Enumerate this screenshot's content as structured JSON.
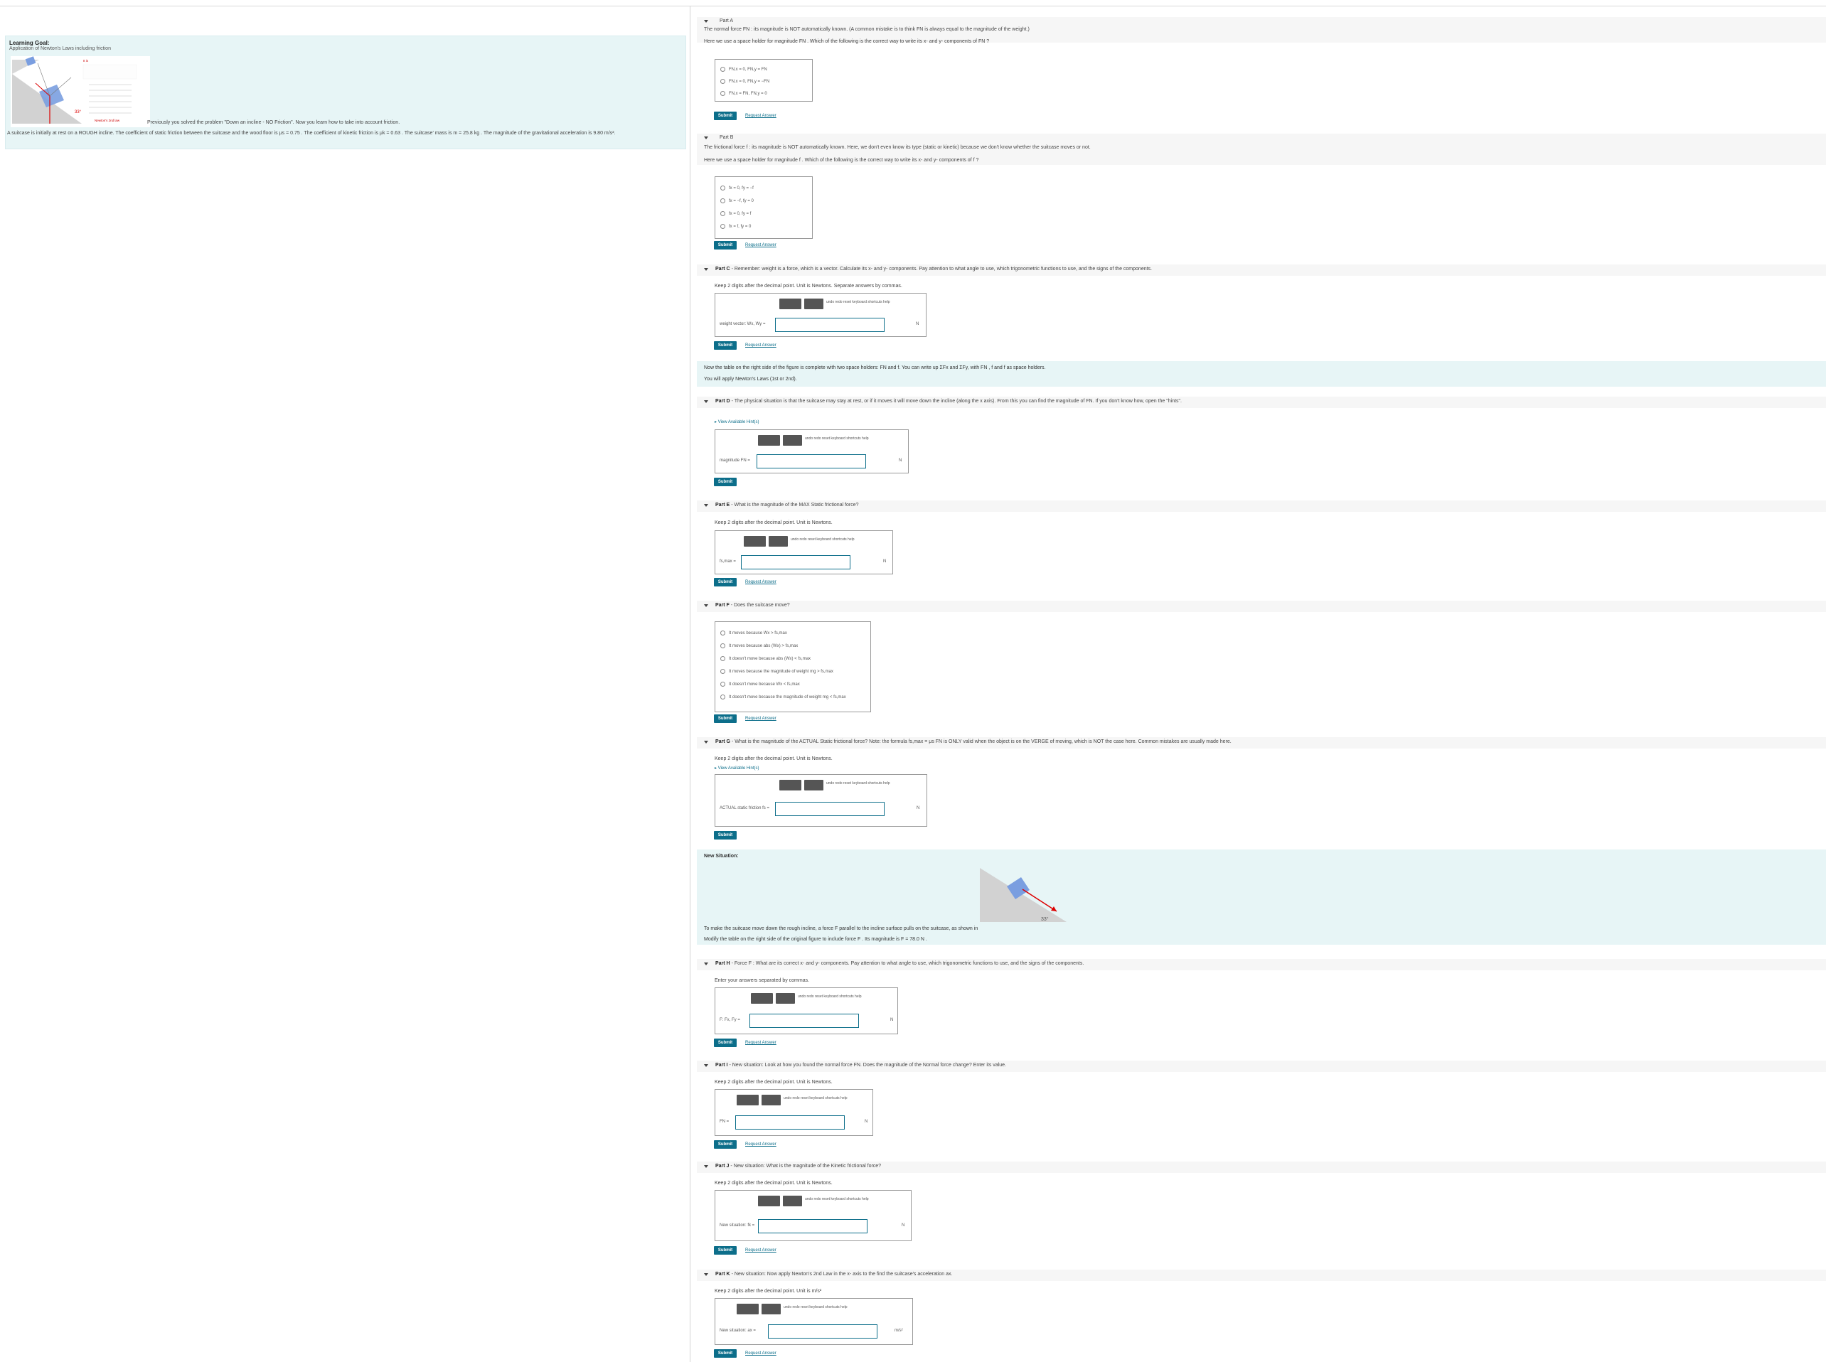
{
  "goal": {
    "title": "Learning Goal:",
    "subtitle": "Application of Newton's Laws including friction",
    "previously": "Previously you solved the problem \"Down an incline - NO Friction\". Now you learn how to take into account friction.",
    "figure_angle": "33°",
    "figure_note": "Newton's 2nd law"
  },
  "intro": "A suitcase is initially at rest on a ROUGH incline. The coefficient of static friction between the suitcase and the wood floor is μs = 0.75 . The coefficient of kinetic friction is μk = 0.63 . The suitcase' mass is m = 25.8 kg . The magnitude of the gravitational acceleration is 9.80 m/s².",
  "colors": {
    "accent": "#0c6e8a",
    "teal_band": "#e7f5f6"
  },
  "toolbar": {
    "templates": "templates",
    "symbols": "symbols",
    "tools": "undo  redo  reset  keyboard shortcuts  help"
  },
  "common": {
    "submit": "Submit",
    "request": "Request Answer",
    "hints": "View Available Hint(s)",
    "unit_N": "N"
  },
  "partA": {
    "title": "Part A",
    "text1": "The normal force FN : its magnitude is NOT automatically known. (A common mistake is to think FN is always equal to the magnitude of the weight.)",
    "text2": "Here we use a space holder for magnitude FN . Which of the following is the correct way to write its x- and y- components of FN ?",
    "choices": [
      "FN,x = 0, FN,y = FN",
      "FN,x = 0, FN,y = −FN",
      "FN,x = FN, FN,y = 0"
    ]
  },
  "partB": {
    "title": "Part B",
    "text1": "The frictional force f : its magnitude is NOT automatically known. Here, we don't even know its type (static or kinetic) because we don't know whether the suitcase moves or not.",
    "text2": "Here we use a space holder for magnitude f . Which of the following is the correct way to write its x- and y- components of f ?",
    "choices": [
      "fx = 0, fy = −f",
      "fx = −f, fy = 0",
      "fx = 0, fy = f",
      "fx = f, fy = 0"
    ]
  },
  "partC": {
    "title": "Part C",
    "text": "- Remember: weight is a force, which is a vector. Calculate its x- and y- components. Pay attention to what angle to use, which trigonometric functions to use, and the signs of the components.",
    "instr": "Keep 2 digits after the decimal point. Unit is Newtons. Separate answers by commas.",
    "label": "weight vector: Wx, Wy ="
  },
  "note1": {
    "line1": "Now the table on the right side of the figure is complete with two space holders: FN and f. You can write up ΣFx and ΣFy, with FN , f and f as space holders.",
    "line2": "You will apply Newton's Laws (1st or 2nd)."
  },
  "partD": {
    "title": "Part D",
    "text": "- The physical situation is that the suitcase may stay at rest, or if it moves it will move down the incline (along the x axis). From this you can find the magnitude of FN. If you don't know how, open the \"hints\".",
    "label": "magnitude FN ="
  },
  "partE": {
    "title": "Part E",
    "text": "- What is the magnitude of the MAX Static frictional force?",
    "instr": "Keep 2 digits after the decimal point. Unit is Newtons.",
    "label": "fs,max ="
  },
  "partF": {
    "title": "Part F",
    "text": "- Does the suitcase move?",
    "choices": [
      "It moves because Wx > fs,max",
      "It moves because abs (Wx) > fs,max",
      "It doesn't move because abs (Wx) < fs,max",
      "It moves because the magnitude of weight mg > fs,max",
      "It doesn't move because Wx < fs,max",
      "It doesn't move because the magnitude of weight mg < fs,max"
    ]
  },
  "partG": {
    "title": "Part G",
    "text": "- What is the magnitude of the ACTUAL Static frictional force? Note: the formula fs,max = μs FN is ONLY valid when the object is on the VERGE of moving, which is NOT the case here. Common mistakes are usually made here.",
    "instr": "Keep 2 digits after the decimal point. Unit is Newtons.",
    "label": "ACTUAL static friction fs ="
  },
  "newSituation": {
    "title": "New Situation:",
    "angle": "33°",
    "line1": "To make the suitcase move down the rough incline, a force F parallel to the incline surface pulls on the suitcase, as shown in",
    "line2": "Modify the table on the right side of the original figure to include force F . Its magnitude is F = 78.0 N ."
  },
  "partH": {
    "title": "Part H",
    "text": "- Force F : What are its correct x- and y- components. Pay attention to what angle to use, which trigonometric functions to use, and the signs of the components.",
    "instr": "Enter your answers separated by commas.",
    "label": "F: Fx, Fy ="
  },
  "partI": {
    "title": "Part I",
    "text": "- New situation: Look at how you found the normal force FN. Does the magnitude of the Normal force change? Enter its value.",
    "instr": "Keep 2 digits after the decimal point. Unit is Newtons.",
    "label": "FN ="
  },
  "partJ": {
    "title": "Part J",
    "text": "- New situation: What is the magnitude of the Kinetic frictional force?",
    "instr": "Keep 2 digits after the decimal point. Unit is Newtons.",
    "label": "New situation: fk ="
  },
  "partK": {
    "title": "Part K",
    "text": "- New situation: Now apply Newton's 2nd Law in the x- axis to the find the suitcase's acceleration ax.",
    "instr": "Keep 2 digits after the decimal point. Unit is m/s²",
    "label": "New situation: ax =",
    "unit": "m/s²"
  }
}
